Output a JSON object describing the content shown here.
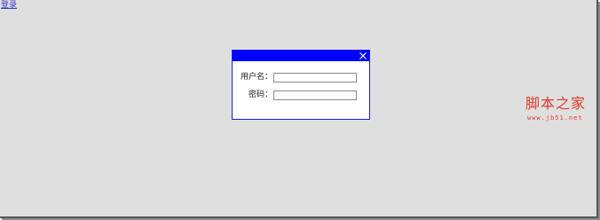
{
  "header": {
    "login_link": "登录"
  },
  "dialog": {
    "title": "",
    "close_icon": "close-icon",
    "username_label": "用户名：",
    "username_value": "",
    "password_label": "密码：",
    "password_value": ""
  },
  "watermark": {
    "text_cn": "脚本之家",
    "text_en": "www.jb51.net"
  },
  "colors": {
    "page_background": "#dfdfdf",
    "titlebar": "#0000ff",
    "dialog_border": "#1a1aee",
    "link": "#3a3acc",
    "watermark": "#e23a2a"
  }
}
